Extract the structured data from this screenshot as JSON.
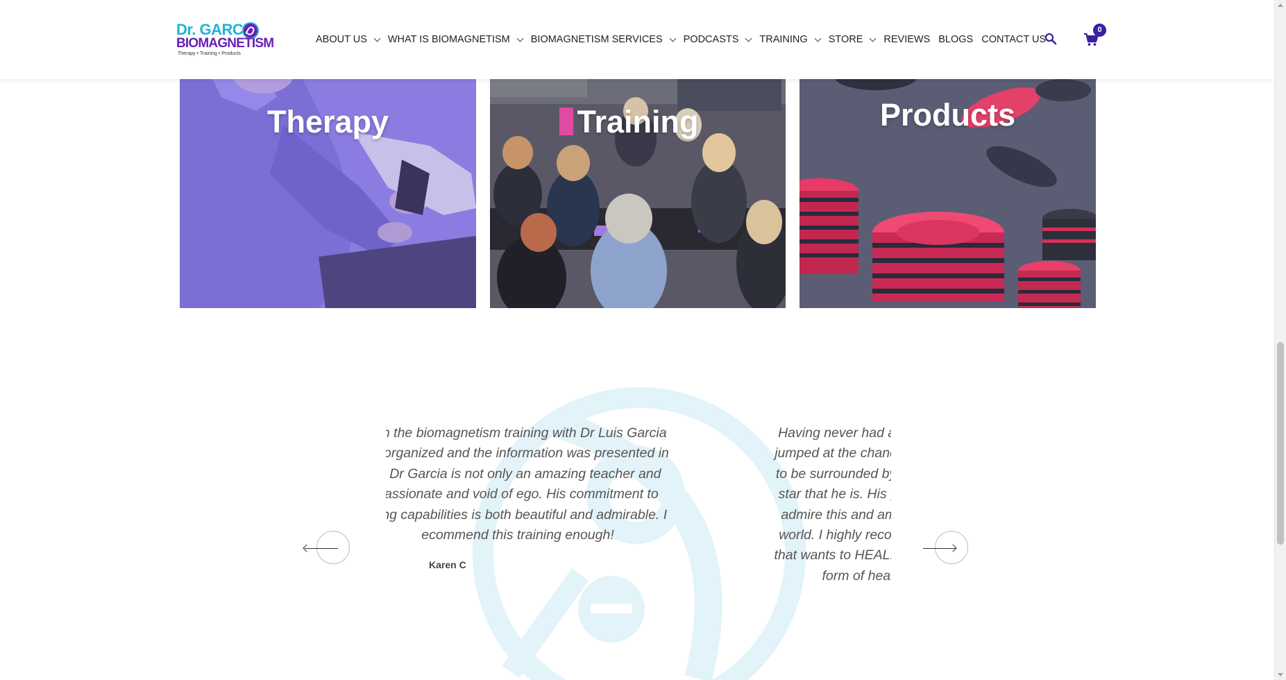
{
  "header": {
    "logo": {
      "line1": "Dr. GARCIA",
      "line2": "BIOMAGNETISM",
      "tagline": "Therapy • Training • Products"
    },
    "nav": [
      {
        "label": "ABOUT US",
        "dropdown": true
      },
      {
        "label": "WHAT IS BIOMAGNETISM",
        "dropdown": true
      },
      {
        "label": "BIOMAGNETISM SERVICES",
        "dropdown": true
      },
      {
        "label": "PODCASTS",
        "dropdown": true
      },
      {
        "label": "TRAINING",
        "dropdown": true
      },
      {
        "label": "STORE",
        "dropdown": true
      },
      {
        "label": "REVIEWS",
        "dropdown": false
      },
      {
        "label": "BLOGS",
        "dropdown": false
      },
      {
        "label": "CONTACT US",
        "dropdown": false
      }
    ],
    "search_icon": "search-icon",
    "cart_icon": "shopping-cart-icon",
    "cart_count": "0",
    "colors": {
      "cart_badge": "#3b1fa1",
      "logo_blue": "#1fb3d9",
      "logo_purple": "#6a1fb7"
    }
  },
  "cards": [
    {
      "title": "Therapy",
      "overlay": "#8c7ee3"
    },
    {
      "title": "Training",
      "overlay": "#4c4a58"
    },
    {
      "title": "Products",
      "overlay": "#585a72"
    }
  ],
  "testimonials": {
    "visible": [
      {
        "lines": [
          "vith the biomagnetism training with Dr Luis Garcia",
          "ell organized and the information was presented in",
          "n. Dr Garcia is not only an amazing teacher and",
          "passionate and void of ego. His commitment to",
          "aling capabilities is both beautiful and admirable. I",
          "ecommend this training enough!"
        ],
        "author": "Karen C"
      },
      {
        "lines": [
          "Having never had a Bioma",
          "jumped at the chance to lea",
          "to be surrounded by his tea",
          "star that he is. His goal is t",
          "admire this and am gratef",
          "world. I highly recommend",
          "that wants to HEAL. Take th",
          "form of heal"
        ],
        "author": ""
      }
    ],
    "prev_icon": "arrow-left-icon",
    "next_icon": "arrow-right-icon",
    "watermark_icon": "biomagnetism-logo-watermark",
    "watermark_color": "#e2f3f9"
  }
}
